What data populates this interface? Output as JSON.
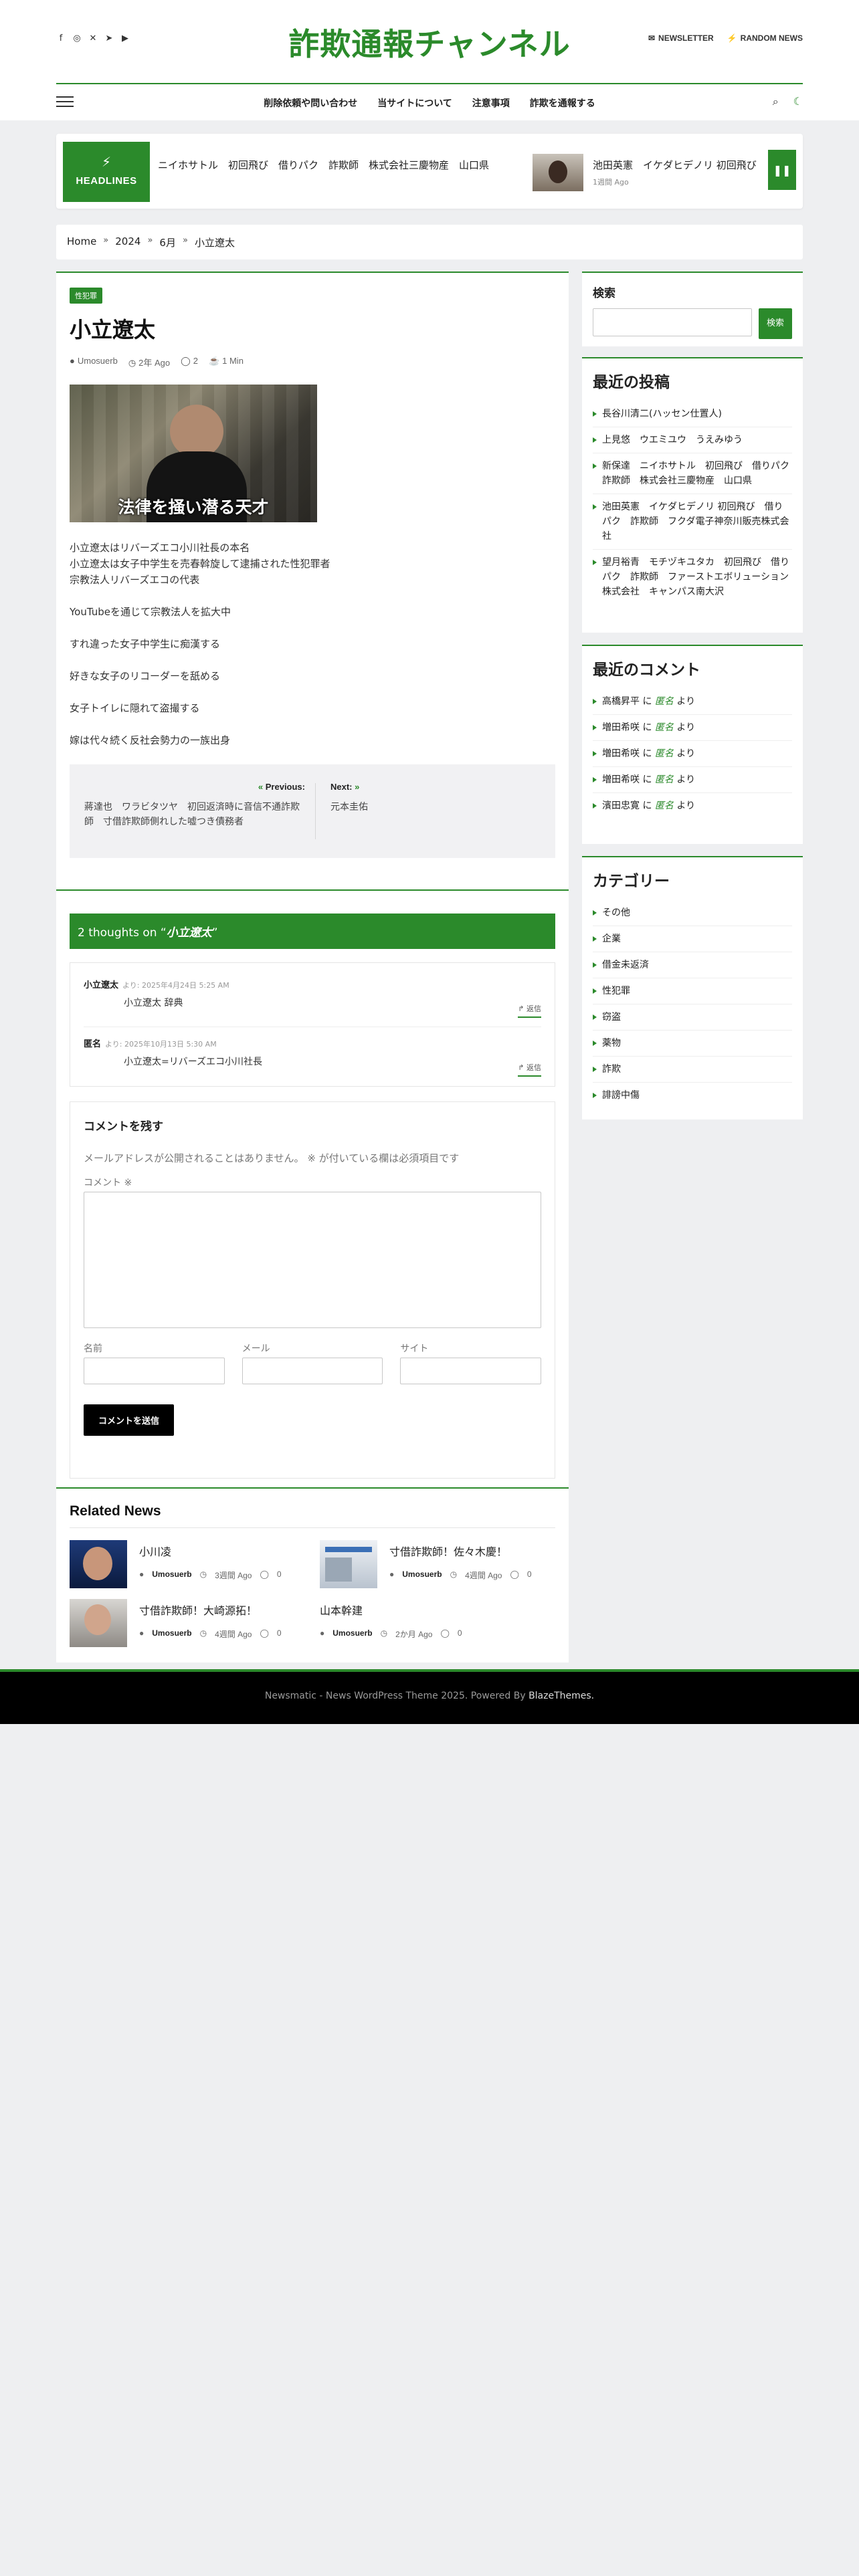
{
  "header": {
    "site_title": "詐欺通報チャンネル",
    "social_icons": [
      "facebook-icon",
      "instagram-icon",
      "x-icon",
      "telegram-icon",
      "youtube-icon"
    ],
    "newsletter": "NEWSLETTER",
    "random_news": "RANDOM NEWS"
  },
  "nav": {
    "items": [
      "削除依頼や問い合わせ",
      "当サイトについて",
      "注意事項",
      "詐欺を通報する"
    ]
  },
  "ticker": {
    "label": "HEADLINES",
    "text1": "ニイホサトル　初回飛び　借りパク　詐欺師　株式会社三慶物産　山口県",
    "text2": "池田英憲　イケダヒデノリ 初回飛び",
    "time2": "1週間 Ago"
  },
  "breadcrumb": [
    "Home",
    "2024",
    "6月",
    "小立遼太"
  ],
  "article": {
    "category": "性犯罪",
    "title": "小立遼太",
    "author": "Umosuerb",
    "date": "2年 Ago",
    "comments": "2",
    "read_time": "1 Min",
    "image_caption": "法律を掻い潜る天才",
    "paragraphs": [
      [
        "小立遼太はリバーズエコ小川社長の本名",
        "小立遼太は女子中学生を売春斡旋して逮捕された性犯罪者",
        "宗教法人リバーズエコの代表"
      ],
      [
        "YouTubeを通じて宗教法人を拡大中"
      ],
      [
        "すれ違った女子中学生に痴漢する"
      ],
      [
        "好きな女子のリコーダーを舐める"
      ],
      [
        "女子トイレに隠れて盗撮する"
      ],
      [
        "嫁は代々続く反社会勢力の一族出身"
      ]
    ],
    "prev_label": "Previous:",
    "prev_title": "蔣達也　ワラビタツヤ　初回返済時に音信不通詐欺師　寸借詐欺師側れした嘘つき債務者",
    "next_label": "Next:",
    "next_title": "元本圭佑"
  },
  "comments": {
    "heading_prefix": "2 thoughts on “",
    "heading_title": "小立遼太",
    "heading_suffix": "”",
    "items": [
      {
        "author": "小立遼太",
        "date": "より: 2025年4月24日 5:25 AM",
        "text": "小立遼太 辞典",
        "reply": "返信"
      },
      {
        "author": "匿名",
        "date": "より: 2025年10月13日 5:30 AM",
        "text": "小立遼太=リバーズエコ小川社長",
        "reply": "返信"
      }
    ],
    "form_title": "コメントを残す",
    "form_note": "メールアドレスが公開されることはありません。 ※ が付いている欄は必須項目です",
    "comment_label": "コメント ※",
    "name_label": "名前",
    "email_label": "メール",
    "site_label": "サイト",
    "submit": "コメントを送信"
  },
  "related": {
    "heading": "Related News",
    "items": [
      {
        "title": "小川凌",
        "author": "Umosuerb",
        "date": "3週間 Ago",
        "comments": "0"
      },
      {
        "title": "寸借詐欺師！佐々木慶！",
        "author": "Umosuerb",
        "date": "4週間 Ago",
        "comments": "0"
      },
      {
        "title": "寸借詐欺師！大崎源拓！",
        "author": "Umosuerb",
        "date": "4週間 Ago",
        "comments": "0"
      },
      {
        "title": "山本幹建",
        "author": "Umosuerb",
        "date": "2か月 Ago",
        "comments": "0"
      }
    ]
  },
  "sidebar": {
    "search_title": "検索",
    "search_button": "検索",
    "recent_posts_title": "最近の投稿",
    "recent_posts": [
      "長谷川清二(ハッセン仕置人)",
      "上見悠　ウエミユウ　うえみゆう",
      "新保達　ニイホサトル　初回飛び　借りパク　詐欺師　株式会社三慶物産　山口県",
      "池田英憲　イケダヒデノリ 初回飛び　借りパク　詐欺師　フクダ電子神奈川販売株式会社",
      "望月裕青　モチヅキユタカ　初回飛び　借りパク　詐欺師　ファーストエボリューション株式会社　キャンパス南大沢"
    ],
    "recent_comments_title": "最近のコメント",
    "recent_comments": [
      {
        "who": "高橋昇平",
        "anon": "匿名"
      },
      {
        "who": "増田希咲",
        "anon": "匿名"
      },
      {
        "who": "増田希咲",
        "anon": "匿名"
      },
      {
        "who": "増田希咲",
        "anon": "匿名"
      },
      {
        "who": "濱田忠寛",
        "anon": "匿名"
      }
    ],
    "comment_connector": " に ",
    "comment_suffix": " より",
    "categories_title": "カテゴリー",
    "categories": [
      "その他",
      "企業",
      "借金未返済",
      "性犯罪",
      "窃盗",
      "薬物",
      "詐欺",
      "誹謗中傷"
    ]
  },
  "footer": {
    "text": "Newsmatic - News WordPress Theme 2025. Powered By ",
    "brand": "BlazeThemes."
  },
  "colors": {
    "accent": "#2b8a2b",
    "footer_bg": "#000000",
    "page_bg": "#eeeff1"
  }
}
